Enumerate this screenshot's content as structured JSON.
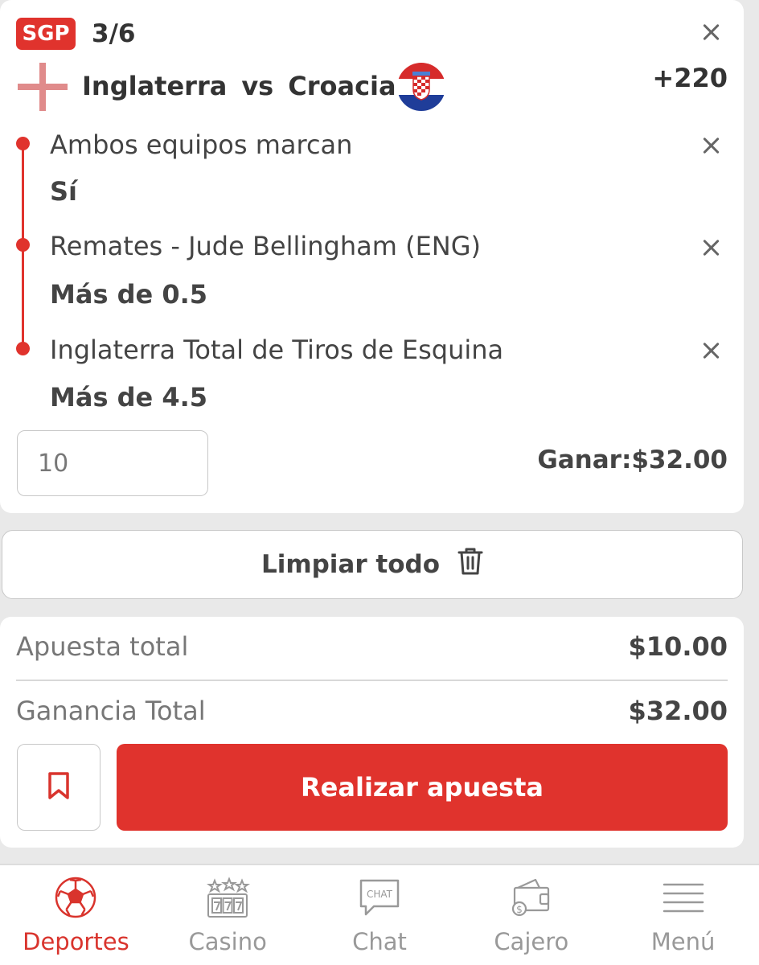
{
  "bet": {
    "badge": "SGP",
    "count": "3/6",
    "home_team": "Inglaterra",
    "vs": "vs",
    "away_team": "Croacia",
    "odds": "+220",
    "legs": [
      {
        "title": "Ambos equipos marcan",
        "selection": "Sí"
      },
      {
        "title": "Remates - Jude Bellingham (ENG)",
        "selection": "Más de 0.5"
      },
      {
        "title": "Inglaterra Total de Tiros de Esquina",
        "selection": "Más de 4.5"
      }
    ],
    "stake_value": "10",
    "win_label": "Ganar:",
    "win_value": "$32.00"
  },
  "clear": {
    "label": "Limpiar todo",
    "icon": "trash-icon"
  },
  "totals": {
    "stake_label": "Apuesta total",
    "stake_value": "$10.00",
    "payout_label": "Ganancia Total",
    "payout_value": "$32.00",
    "place_label": "Realizar apuesta"
  },
  "nav": {
    "items": [
      {
        "label": "Deportes",
        "icon": "soccer-ball-icon",
        "active": true
      },
      {
        "label": "Casino",
        "icon": "slot-machine-icon"
      },
      {
        "label": "Chat",
        "icon": "chat-bubble-icon"
      },
      {
        "label": "Cajero",
        "icon": "wallet-icon"
      },
      {
        "label": "Menú",
        "icon": "hamburger-menu-icon"
      }
    ],
    "chat_icon_text": "CHAT"
  },
  "colors": {
    "accent": "#e0332d",
    "active_nav": "#d9342d"
  }
}
